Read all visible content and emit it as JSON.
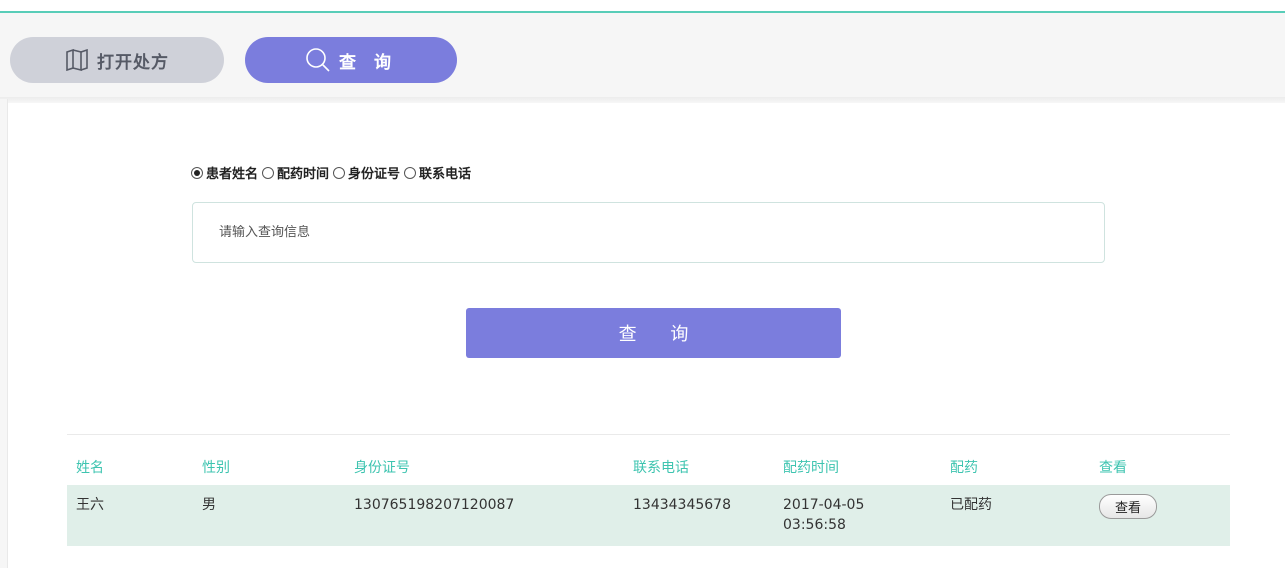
{
  "tabs": [
    {
      "label": "打开处方",
      "icon": "book-icon"
    },
    {
      "label": "查 询",
      "icon": "search-icon"
    }
  ],
  "search_types": {
    "options": [
      "患者姓名",
      "配药时间",
      "身份证号",
      "联系电话"
    ],
    "selected": "患者姓名"
  },
  "search": {
    "placeholder": "请输入查询信息",
    "value": "",
    "button_label": "查 询"
  },
  "table": {
    "headers": [
      "姓名",
      "性别",
      "身份证号",
      "联系电话",
      "配药时间",
      "配药",
      "查看"
    ],
    "rows": [
      {
        "name": "王六",
        "gender": "男",
        "id_number": "130765198207120087",
        "phone": "13434345678",
        "dispense_date": "2017-04-05",
        "dispense_time": "03:56:58",
        "status": "已配药",
        "view_label": "查看"
      }
    ]
  },
  "colors": {
    "accent": "#7b7ddd",
    "header_text": "#3ec4b0",
    "row_background": "#e0efe9",
    "top_line": "#58cdb8"
  }
}
